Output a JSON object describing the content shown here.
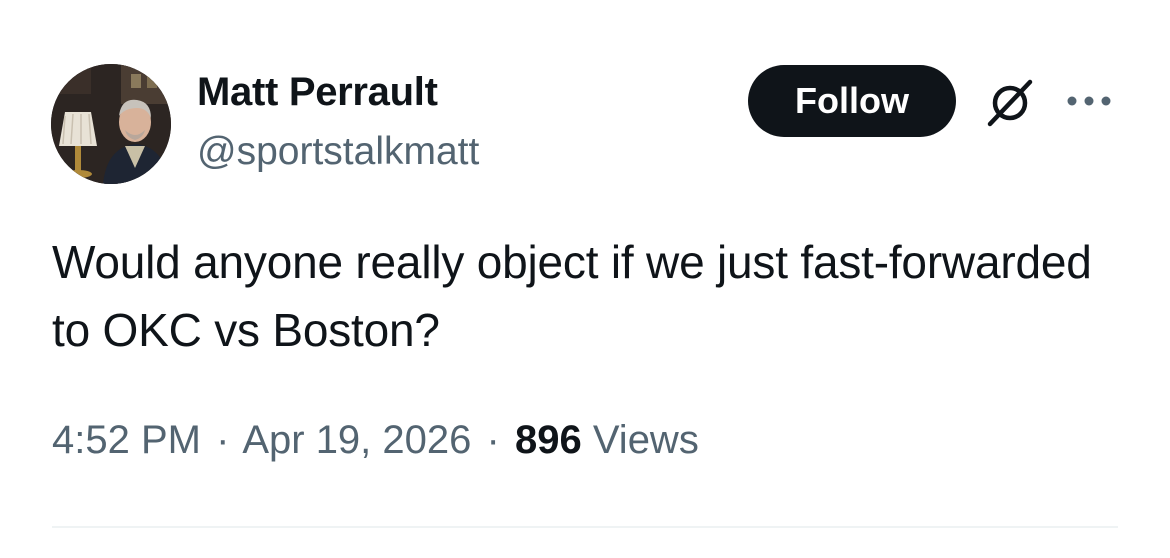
{
  "author": {
    "name": "Matt Perrault",
    "handle": "@sportstalkmatt"
  },
  "actions": {
    "follow_label": "Follow",
    "grok_icon": "grok-icon",
    "more_icon": "more-icon"
  },
  "tweet": {
    "text": "Would anyone really object if we just fast-forwarded to OKC vs Boston?"
  },
  "meta": {
    "time": "4:52 PM",
    "separator": "·",
    "date": "Apr 19, 2026",
    "views_count": "896",
    "views_label": "Views"
  },
  "colors": {
    "text_primary": "#0f1419",
    "text_secondary": "#536471",
    "button_bg": "#0f1419",
    "divider": "#eff3f4"
  }
}
